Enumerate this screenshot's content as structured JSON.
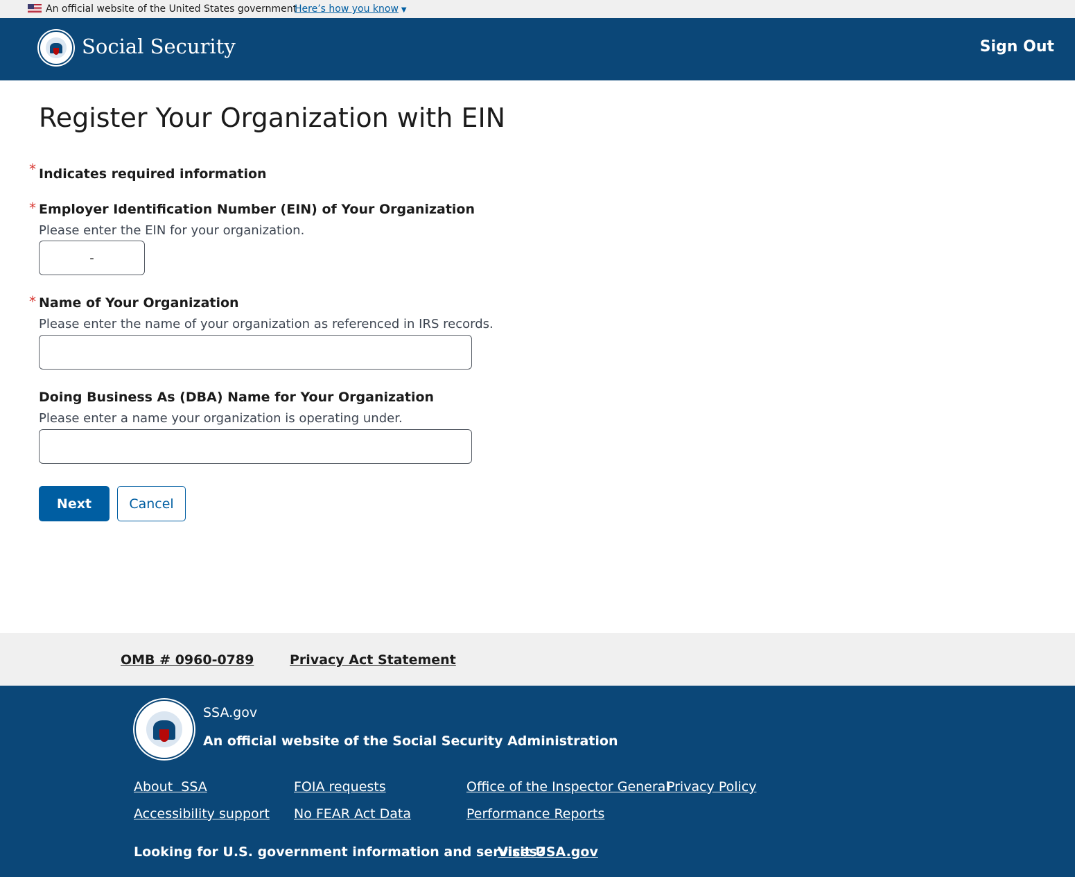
{
  "gov_banner": {
    "text": "An official website of the United States government",
    "link": "Here’s how you know"
  },
  "header": {
    "brand": "Social Security",
    "sign_out": "Sign Out"
  },
  "main": {
    "title": "Register Your Organization with EIN",
    "required_note": "Indicates required information",
    "required_marker": "*",
    "ein": {
      "label": "Employer Identification Number (EIN) of Your Organization",
      "hint": "Please enter the EIN for your organization.",
      "value": "-"
    },
    "org_name": {
      "label": "Name of Your Organization",
      "hint": "Please enter the name of your organization as referenced in IRS records.",
      "value": ""
    },
    "dba_name": {
      "label": "Doing Business As (DBA) Name for Your Organization",
      "hint": "Please enter a name your organization is operating under.",
      "value": ""
    },
    "buttons": {
      "next": "Next",
      "cancel": "Cancel"
    }
  },
  "footer_top": {
    "omb": "OMB # 0960-0789",
    "privacy_act": "Privacy Act Statement"
  },
  "footer": {
    "site": "SSA.gov",
    "official": "An official website of the Social Security Administration",
    "links": {
      "about": "About  SSA",
      "foia": "FOIA requests",
      "oig": "Office of the Inspector General",
      "privacy_policy": "Privacy Policy",
      "accessibility": "Accessibility support",
      "no_fear": "No FEAR Act Data",
      "performance": "Performance Reports"
    },
    "looking": "Looking for U.S. government information and services?",
    "visit_usa": "Visit USA.gov"
  },
  "colors": {
    "header_bg": "#0b4778",
    "primary_button": "#005ea2",
    "required_star": "#d83933",
    "banner_bg": "#f0f0f0"
  }
}
